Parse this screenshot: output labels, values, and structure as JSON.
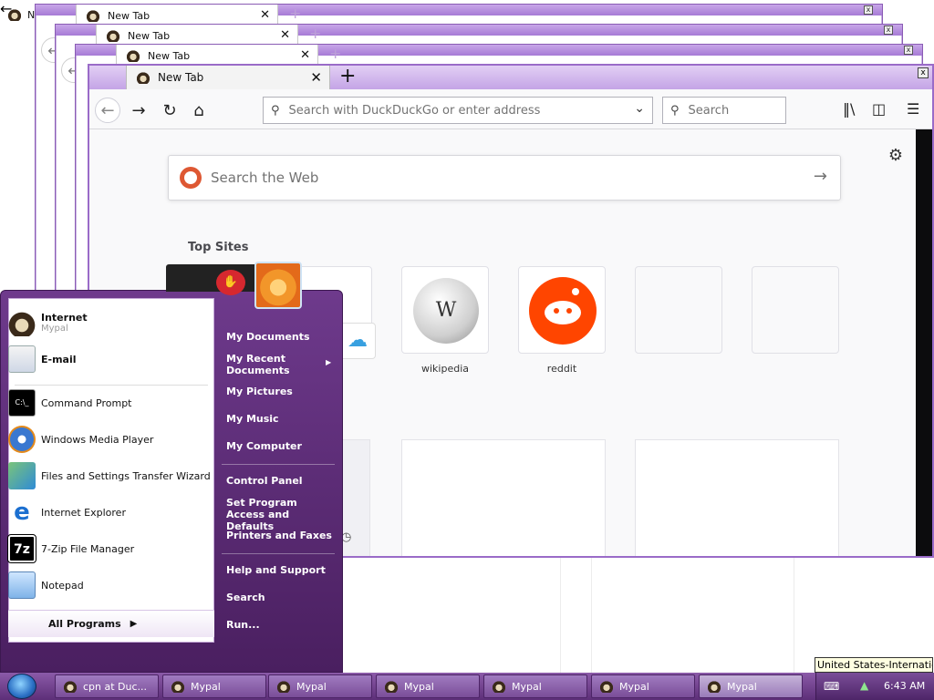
{
  "browser": {
    "tab_title": "New Tab",
    "new_tab_symbol": "+",
    "close_symbol": "✕",
    "tiny_close_symbol": "x",
    "url_placeholder": "Search with DuckDuckGo or enter address",
    "search_placeholder": "Search",
    "web_search_placeholder": "Search the Web",
    "top_sites_title": "Top Sites",
    "top_sites": [
      {
        "label": "wikipedia"
      },
      {
        "label": "reddit"
      }
    ],
    "peek_label_fragment": "N"
  },
  "start_menu": {
    "pinned": [
      {
        "title": "Internet",
        "subtitle": "Mypal"
      },
      {
        "title": "E-mail"
      }
    ],
    "recent": [
      {
        "label": "Command Prompt"
      },
      {
        "label": "Windows Media Player"
      },
      {
        "label": "Files and Settings Transfer Wizard"
      },
      {
        "label": "Internet Explorer"
      },
      {
        "label": "7-Zip File Manager"
      },
      {
        "label": "Notepad"
      }
    ],
    "all_programs": "All Programs",
    "right_items": [
      {
        "label": "My Documents"
      },
      {
        "label": "My Recent Documents"
      },
      {
        "label": "My Pictures"
      },
      {
        "label": "My Music"
      },
      {
        "label": "My Computer"
      },
      {
        "label": "Control Panel"
      },
      {
        "label": "Set Program Access and Defaults"
      },
      {
        "label": "Printers and Faxes"
      },
      {
        "label": "Help and Support"
      },
      {
        "label": "Search"
      },
      {
        "label": "Run..."
      }
    ]
  },
  "taskbar": {
    "buttons": [
      {
        "label": "cpn at Duc..."
      },
      {
        "label": "Mypal"
      },
      {
        "label": "Mypal"
      },
      {
        "label": "Mypal"
      },
      {
        "label": "Mypal"
      },
      {
        "label": "Mypal"
      },
      {
        "label": "Mypal",
        "active": true
      }
    ],
    "clock": "6:43 AM",
    "tooltip": "United States-International"
  },
  "colors": {
    "theme_purple": "#8a5cb4",
    "taskbar": "#6e3a8c",
    "reddit_orange": "#ff4500",
    "ddg_orange": "#de5833"
  },
  "icons": {
    "back": "arrow-left-icon",
    "forward": "arrow-right-icon",
    "reload": "reload-icon",
    "home": "home-icon",
    "library": "library-icon",
    "sidebar": "sidebar-icon",
    "menu": "hamburger-menu-icon",
    "settings": "gear-icon"
  }
}
